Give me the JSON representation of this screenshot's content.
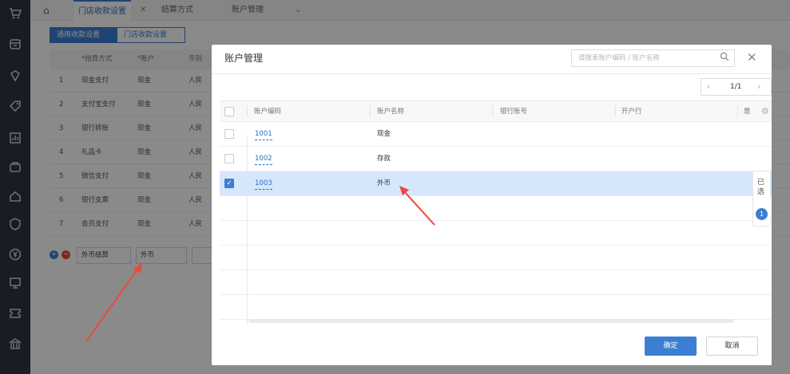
{
  "colors": {
    "accent": "#3b7fd3",
    "sidebar": "#2f3540",
    "danger": "#e9493a",
    "selected_row": "#d6e7fb"
  },
  "sidebar": {
    "icons": [
      "cart-icon",
      "store-icon",
      "diamond-icon",
      "tag-icon",
      "chart-icon",
      "bag-icon",
      "home-icon",
      "shield-icon",
      "yen-icon",
      "presentation-icon",
      "ticket-icon",
      "bank-icon"
    ]
  },
  "tabs": [
    {
      "label": "门店收款设置"
    },
    {
      "label": "结算方式"
    },
    {
      "label": "账户管理"
    }
  ],
  "subtabs": [
    "通用收款设置",
    "门店收款设置"
  ],
  "bg_table": {
    "headers": [
      "结算方式",
      "账户",
      "币别"
    ],
    "rows": [
      {
        "no": "1",
        "method": "现金支付",
        "account": "现金",
        "cur": "人民"
      },
      {
        "no": "2",
        "method": "支付宝支付",
        "account": "现金",
        "cur": "人民"
      },
      {
        "no": "3",
        "method": "银行转账",
        "account": "现金",
        "cur": "人民"
      },
      {
        "no": "4",
        "method": "礼品卡",
        "account": "现金",
        "cur": "人民"
      },
      {
        "no": "5",
        "method": "微信支付",
        "account": "现金",
        "cur": "人民"
      },
      {
        "no": "6",
        "method": "银行支票",
        "account": "现金",
        "cur": "人民"
      },
      {
        "no": "7",
        "method": "会员支付",
        "account": "现金",
        "cur": "人民"
      }
    ],
    "edit_row": {
      "method": "外币结算",
      "account": "外币"
    }
  },
  "modal": {
    "title": "账户管理",
    "search_placeholder": "请搜索账户编码 / 账户名称",
    "pager": "1/1",
    "columns": [
      "账户编码",
      "账户名称",
      "银行账号",
      "开户行",
      "是"
    ],
    "rows": [
      {
        "code": "1001",
        "name": "现金",
        "checked": false
      },
      {
        "code": "1002",
        "name": "存款",
        "checked": false
      },
      {
        "code": "1003",
        "name": "外币",
        "checked": true
      }
    ],
    "selected_label": "已选",
    "selected_count": "1",
    "ok_label": "确定",
    "cancel_label": "取消"
  }
}
